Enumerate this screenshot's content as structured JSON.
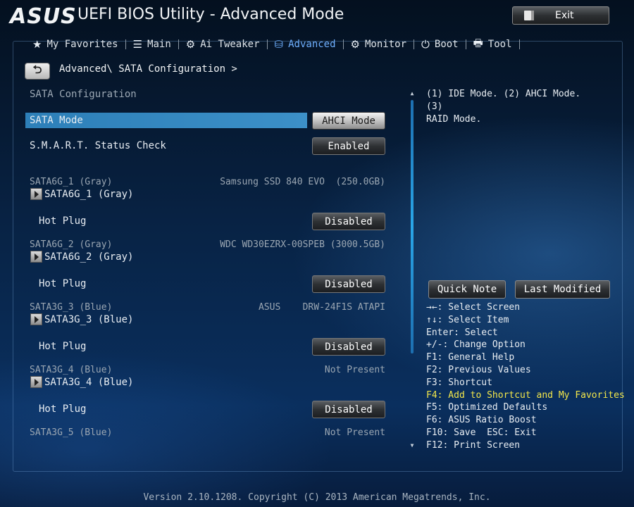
{
  "header": {
    "logo": "ASUS",
    "title": "UEFI BIOS Utility - Advanced Mode",
    "exit_label": "Exit"
  },
  "tabs": [
    {
      "label": "My Favorites",
      "icon": "star-icon",
      "glyph": "★",
      "active": false
    },
    {
      "label": "Main",
      "icon": "list-icon",
      "glyph": "☰",
      "active": false
    },
    {
      "label": "Ai Tweaker",
      "icon": "tweaker-icon",
      "glyph": "⚙",
      "active": false
    },
    {
      "label": "Advanced",
      "icon": "advanced-icon",
      "glyph": "⛁",
      "active": true
    },
    {
      "label": "Monitor",
      "icon": "monitor-icon",
      "glyph": "⚙",
      "active": false
    },
    {
      "label": "Boot",
      "icon": "power-icon",
      "glyph": "⏻",
      "active": false
    },
    {
      "label": "Tool",
      "icon": "tool-icon",
      "glyph": "🖶",
      "active": false
    }
  ],
  "breadcrumb": "Advanced\\ SATA Configuration >",
  "section_title": "SATA Configuration",
  "sata_mode": {
    "label": "SATA Mode",
    "value": "AHCI Mode"
  },
  "smart": {
    "label": "S.M.A.R.T. Status Check",
    "value": "Enabled"
  },
  "ports": [
    {
      "name": "SATA6G_1 (Gray)",
      "device": "Samsung SSD 840 EVO  (250.0GB)",
      "submenu": "SATA6G_1 (Gray)",
      "hotplug_label": "Hot Plug",
      "hotplug_value": "Disabled"
    },
    {
      "name": "SATA6G_2 (Gray)",
      "device": "WDC WD30EZRX-00SPEB (3000.5GB)",
      "submenu": "SATA6G_2 (Gray)",
      "hotplug_label": "Hot Plug",
      "hotplug_value": "Disabled"
    },
    {
      "name": "SATA3G_3 (Blue)",
      "device": "ASUS    DRW-24F1S ATAPI",
      "submenu": "SATA3G_3 (Blue)",
      "hotplug_label": "Hot Plug",
      "hotplug_value": "Disabled"
    },
    {
      "name": "SATA3G_4 (Blue)",
      "device": "Not Present",
      "submenu": "SATA3G_4 (Blue)",
      "hotplug_label": "Hot Plug",
      "hotplug_value": "Disabled"
    },
    {
      "name": "SATA3G_5 (Blue)",
      "device": "Not Present"
    }
  ],
  "help": {
    "line1": "(1) IDE Mode. (2) AHCI Mode. (3)",
    "line2": "RAID Mode."
  },
  "buttons": {
    "quick_note": "Quick Note",
    "last_modified": "Last Modified"
  },
  "keys": [
    "→←: Select Screen",
    "↑↓: Select Item",
    "Enter: Select",
    "+/-: Change Option",
    "F1: General Help",
    "F2: Previous Values",
    "F3: Shortcut",
    "F4: Add to Shortcut and My Favorites",
    "F5: Optimized Defaults",
    "F6: ASUS Ratio Boost",
    "F10: Save  ESC: Exit",
    "F12: Print Screen"
  ],
  "highlight_key_index": 7,
  "footer": "Version 2.10.1208. Copyright (C) 2013 American Megatrends, Inc.",
  "colors": {
    "active_tab": "#6fb0ff",
    "highlight_row": "#3c90c8",
    "key_highlight": "#f2e64a"
  }
}
